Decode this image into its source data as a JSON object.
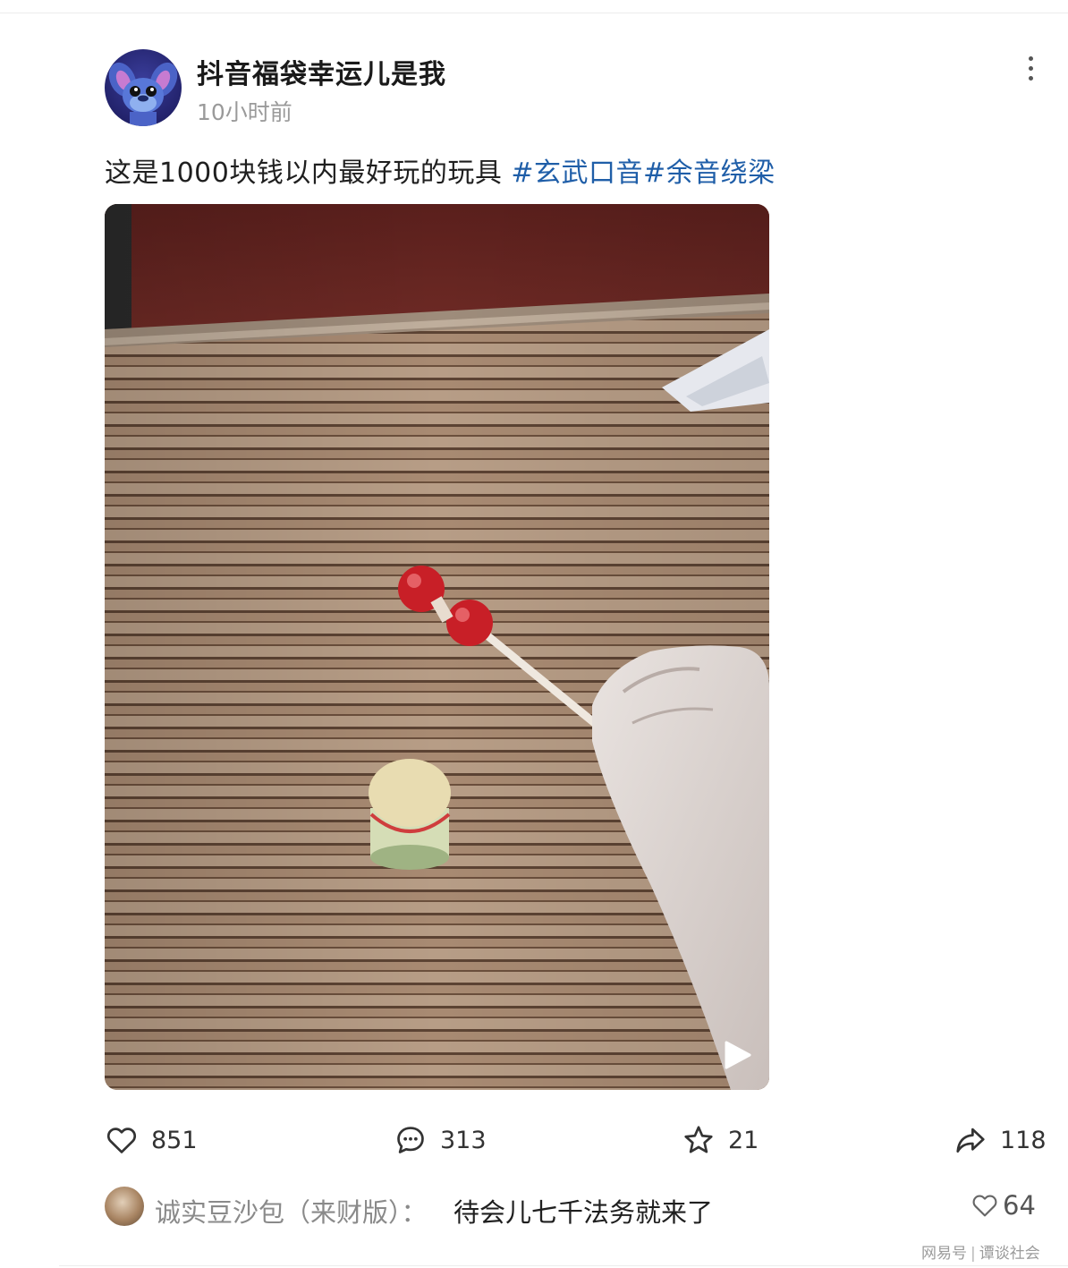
{
  "post": {
    "author": "抖音福袋幸运儿是我",
    "time": "10小时前",
    "text": "这是1000块钱以内最好玩的玩具 ",
    "hashtags": [
      "#玄武口音",
      "#余音绕梁"
    ]
  },
  "actions": {
    "likes": "851",
    "comments": "313",
    "favorites": "21",
    "shares": "118"
  },
  "top_comment": {
    "author": "诚实豆沙包（来财版）：",
    "text": "待会儿七千法务就来了",
    "likes": "64"
  },
  "watermark": {
    "platform": "网易号",
    "source": "谭谈社会"
  },
  "icons": {
    "more": "more-vertical-icon",
    "like": "heart-icon",
    "comment": "comment-bubble-icon",
    "favorite": "star-icon",
    "share": "share-arrow-icon",
    "play": "play-icon"
  },
  "colors": {
    "hashtag": "#1f5ea8",
    "muted": "#9a9a9a"
  }
}
